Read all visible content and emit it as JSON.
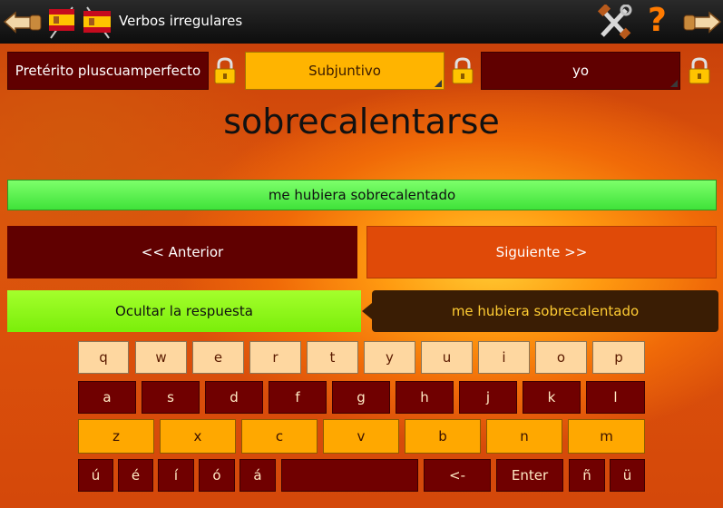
{
  "header": {
    "title": "Verbos irregulares",
    "back_icon": "hand-pointing-left-icon",
    "flags_icon": "spanish-flags-icon",
    "settings_icon": "tools-icon",
    "help_icon": "question-mark-icon",
    "forward_icon": "hand-pointing-right-icon"
  },
  "selectors": {
    "tense": "Pretérito pluscuamperfecto",
    "mood": "Subjuntivo",
    "person": "yo",
    "lock_icon": "padlock-icon"
  },
  "verb": "sobrecalentarse",
  "answer_input": "me hubiera sobrecalentado",
  "nav": {
    "previous": "<< Anterior",
    "next": "Siguiente >>"
  },
  "hide_answer": "Ocultar la respuesta",
  "answer_bubble": "me hubiera sobrecalentado",
  "keyboard": {
    "row1": [
      "q",
      "w",
      "e",
      "r",
      "t",
      "y",
      "u",
      "i",
      "o",
      "p"
    ],
    "row2": [
      "a",
      "s",
      "d",
      "f",
      "g",
      "h",
      "j",
      "k",
      "l"
    ],
    "row3": [
      "z",
      "x",
      "c",
      "v",
      "b",
      "n",
      "m"
    ],
    "row4": [
      "ú",
      "é",
      "í",
      "ó",
      "á",
      "",
      "<-",
      "Enter",
      "ñ",
      "ü"
    ]
  },
  "colors": {
    "dark_red": "#600000",
    "amber": "#ffb400",
    "green": "#3fe23a",
    "lime": "#7aee0a",
    "bubble": "#3a1d04"
  }
}
